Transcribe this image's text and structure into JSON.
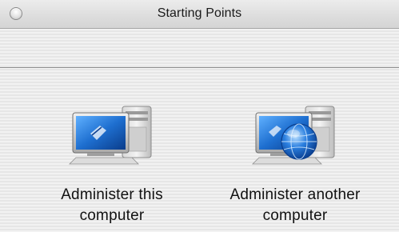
{
  "window": {
    "title": "Starting Points"
  },
  "options": [
    {
      "label_line1": "Administer this",
      "label_line2": "computer",
      "icon": "computer-icon"
    },
    {
      "label_line1": "Administer another",
      "label_line2": "computer",
      "icon": "network-computer-icon"
    }
  ],
  "colors": {
    "screen_blue": "#1e6fd0",
    "globe_blue": "#2a7fe0"
  }
}
